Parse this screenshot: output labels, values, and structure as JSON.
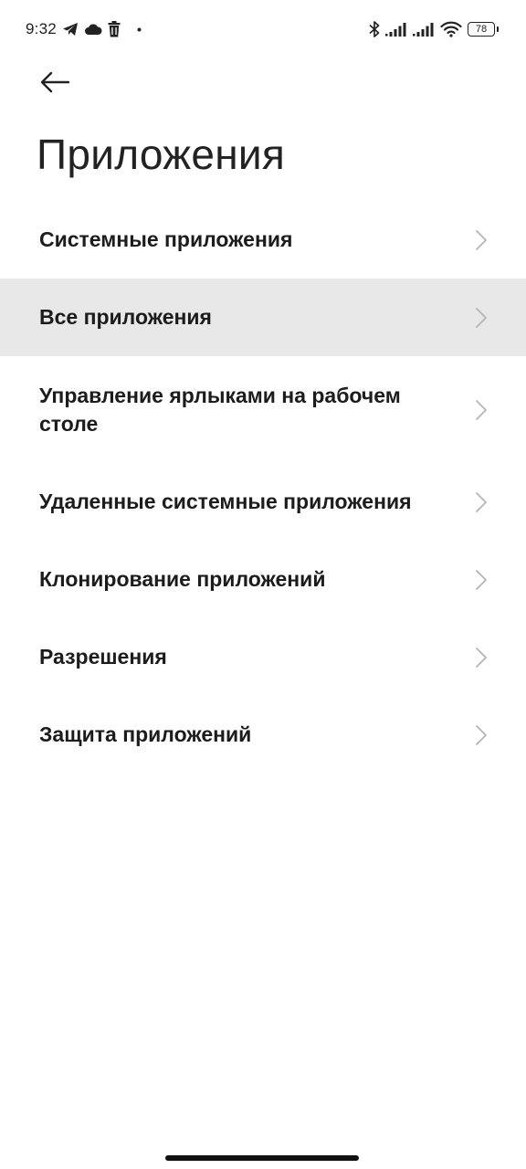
{
  "status_bar": {
    "time": "9:32",
    "left_icons": [
      "telegram-icon",
      "cloud-icon",
      "trash-icon",
      "dot-icon"
    ],
    "right_icons": [
      "bluetooth-icon",
      "signal-icon",
      "signal-icon",
      "wifi-icon"
    ],
    "battery_level": "78"
  },
  "header": {
    "back_icon": "arrow-left-icon",
    "title": "Приложения"
  },
  "menu": {
    "items": [
      {
        "label": "Системные приложения"
      },
      {
        "label": "Все приложения"
      },
      {
        "label": "Управление ярлыками на рабочем столе"
      },
      {
        "label": "Удаленные системные приложения"
      },
      {
        "label": "Клонирование приложений"
      },
      {
        "label": "Разрешения"
      },
      {
        "label": "Защита приложений"
      }
    ],
    "highlighted_index": 1
  },
  "colors": {
    "background": "#ffffff",
    "highlight": "#e8e8e8",
    "text": "#1c1c1c",
    "chevron": "#b5b5b5"
  }
}
